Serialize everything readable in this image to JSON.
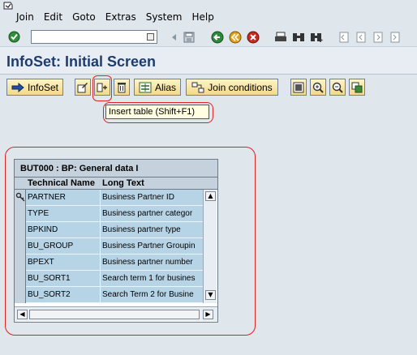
{
  "menu": [
    "Join",
    "Edit",
    "Goto",
    "Extras",
    "System",
    "Help"
  ],
  "command_field": {
    "value": ""
  },
  "title": "InfoSet: Initial Screen",
  "app_toolbar": {
    "infoset_label": "InfoSet",
    "alias_label": "Alias",
    "join_conditions_label": "Join conditions"
  },
  "tooltip": "Insert table   (Shift+F1)",
  "table_panel": {
    "title": "BUT000 : BP: General data I",
    "columns": [
      "Technical Name",
      "Long Text"
    ],
    "rows": [
      {
        "name": "PARTNER",
        "text": "Business Partner ID",
        "key": true
      },
      {
        "name": "TYPE",
        "text": "Business partner categor",
        "key": false
      },
      {
        "name": "BPKIND",
        "text": "Business partner type",
        "key": false
      },
      {
        "name": "BU_GROUP",
        "text": "Business Partner Groupin",
        "key": false
      },
      {
        "name": "BPEXT",
        "text": "Business partner number",
        "key": false
      },
      {
        "name": "BU_SORT1",
        "text": "Search term 1 for busines",
        "key": false
      },
      {
        "name": "BU_SORT2",
        "text": "Search Term 2 for Busine",
        "key": false
      }
    ]
  },
  "colors": {
    "title_text": "#1f3c6d",
    "row_bg": "#b7d4e6",
    "highlight_red": "#dd2222",
    "tooltip_bg": "#ffffe1"
  }
}
